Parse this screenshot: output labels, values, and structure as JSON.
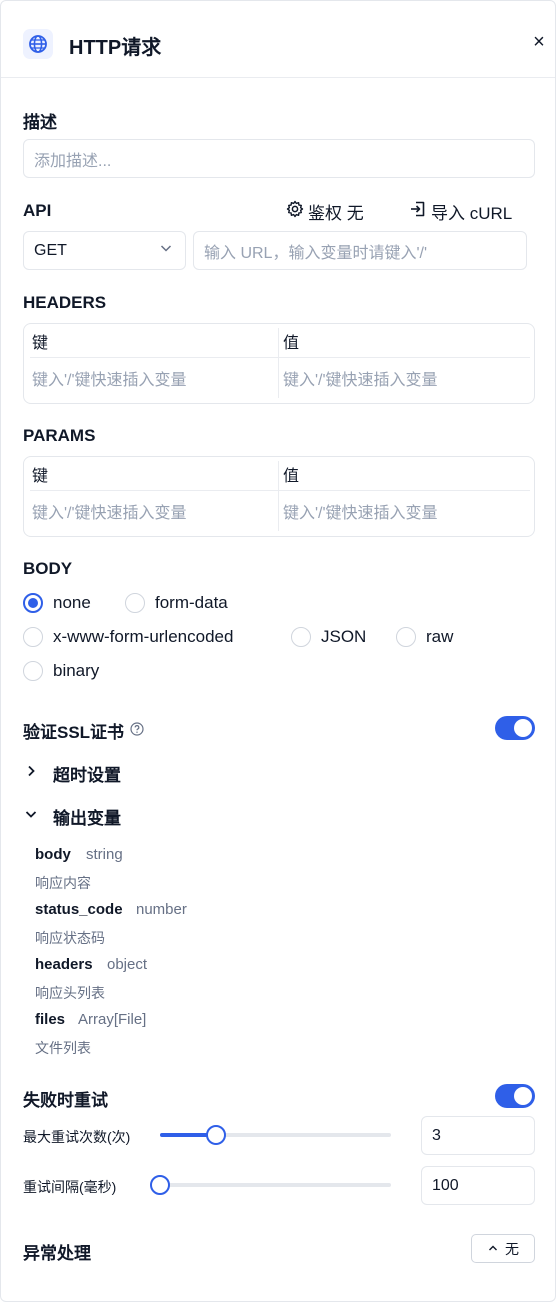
{
  "header": {
    "title": "HTTP请求",
    "close_glyph": "×",
    "icon": "globe-icon"
  },
  "description": {
    "label": "描述",
    "placeholder": "添加描述..."
  },
  "api": {
    "label": "API",
    "auth_label": "鉴权 无",
    "import_label": "导入 cURL",
    "method": "GET",
    "url_placeholder": "输入 URL，输入变量时请键入'/'"
  },
  "headers": {
    "label": "HEADERS",
    "col_key": "键",
    "col_value": "值",
    "key_placeholder": "键入'/'键快速插入变量",
    "value_placeholder": "键入'/'键快速插入变量"
  },
  "params": {
    "label": "PARAMS",
    "col_key": "键",
    "col_value": "值",
    "key_placeholder": "键入'/'键快速插入变量",
    "value_placeholder": "键入'/'键快速插入变量"
  },
  "body": {
    "label": "BODY",
    "options": [
      "none",
      "form-data",
      "x-www-form-urlencoded",
      "JSON",
      "raw",
      "binary"
    ],
    "selected": "none"
  },
  "ssl": {
    "label": "验证SSL证书",
    "enabled": true
  },
  "timeout": {
    "label": "超时设置",
    "expanded": false
  },
  "output": {
    "label": "输出变量",
    "expanded": true,
    "vars": [
      {
        "name": "body",
        "type": "string",
        "desc": "响应内容"
      },
      {
        "name": "status_code",
        "type": "number",
        "desc": "响应状态码"
      },
      {
        "name": "headers",
        "type": "object",
        "desc": "响应头列表"
      },
      {
        "name": "files",
        "type": "Array[File]",
        "desc": "文件列表"
      }
    ]
  },
  "retry": {
    "label": "失败时重试",
    "enabled": true,
    "max_label": "最大重试次数(次)",
    "max_value": "3",
    "max_fraction": 0.22,
    "interval_label": "重试间隔(毫秒)",
    "interval_value": "100",
    "interval_fraction": 0.0
  },
  "error": {
    "label": "异常处理",
    "button_label": "无"
  },
  "colors": {
    "accent": "#2f5fe8",
    "border": "#e4e7ec",
    "muted": "#98a2b3"
  }
}
